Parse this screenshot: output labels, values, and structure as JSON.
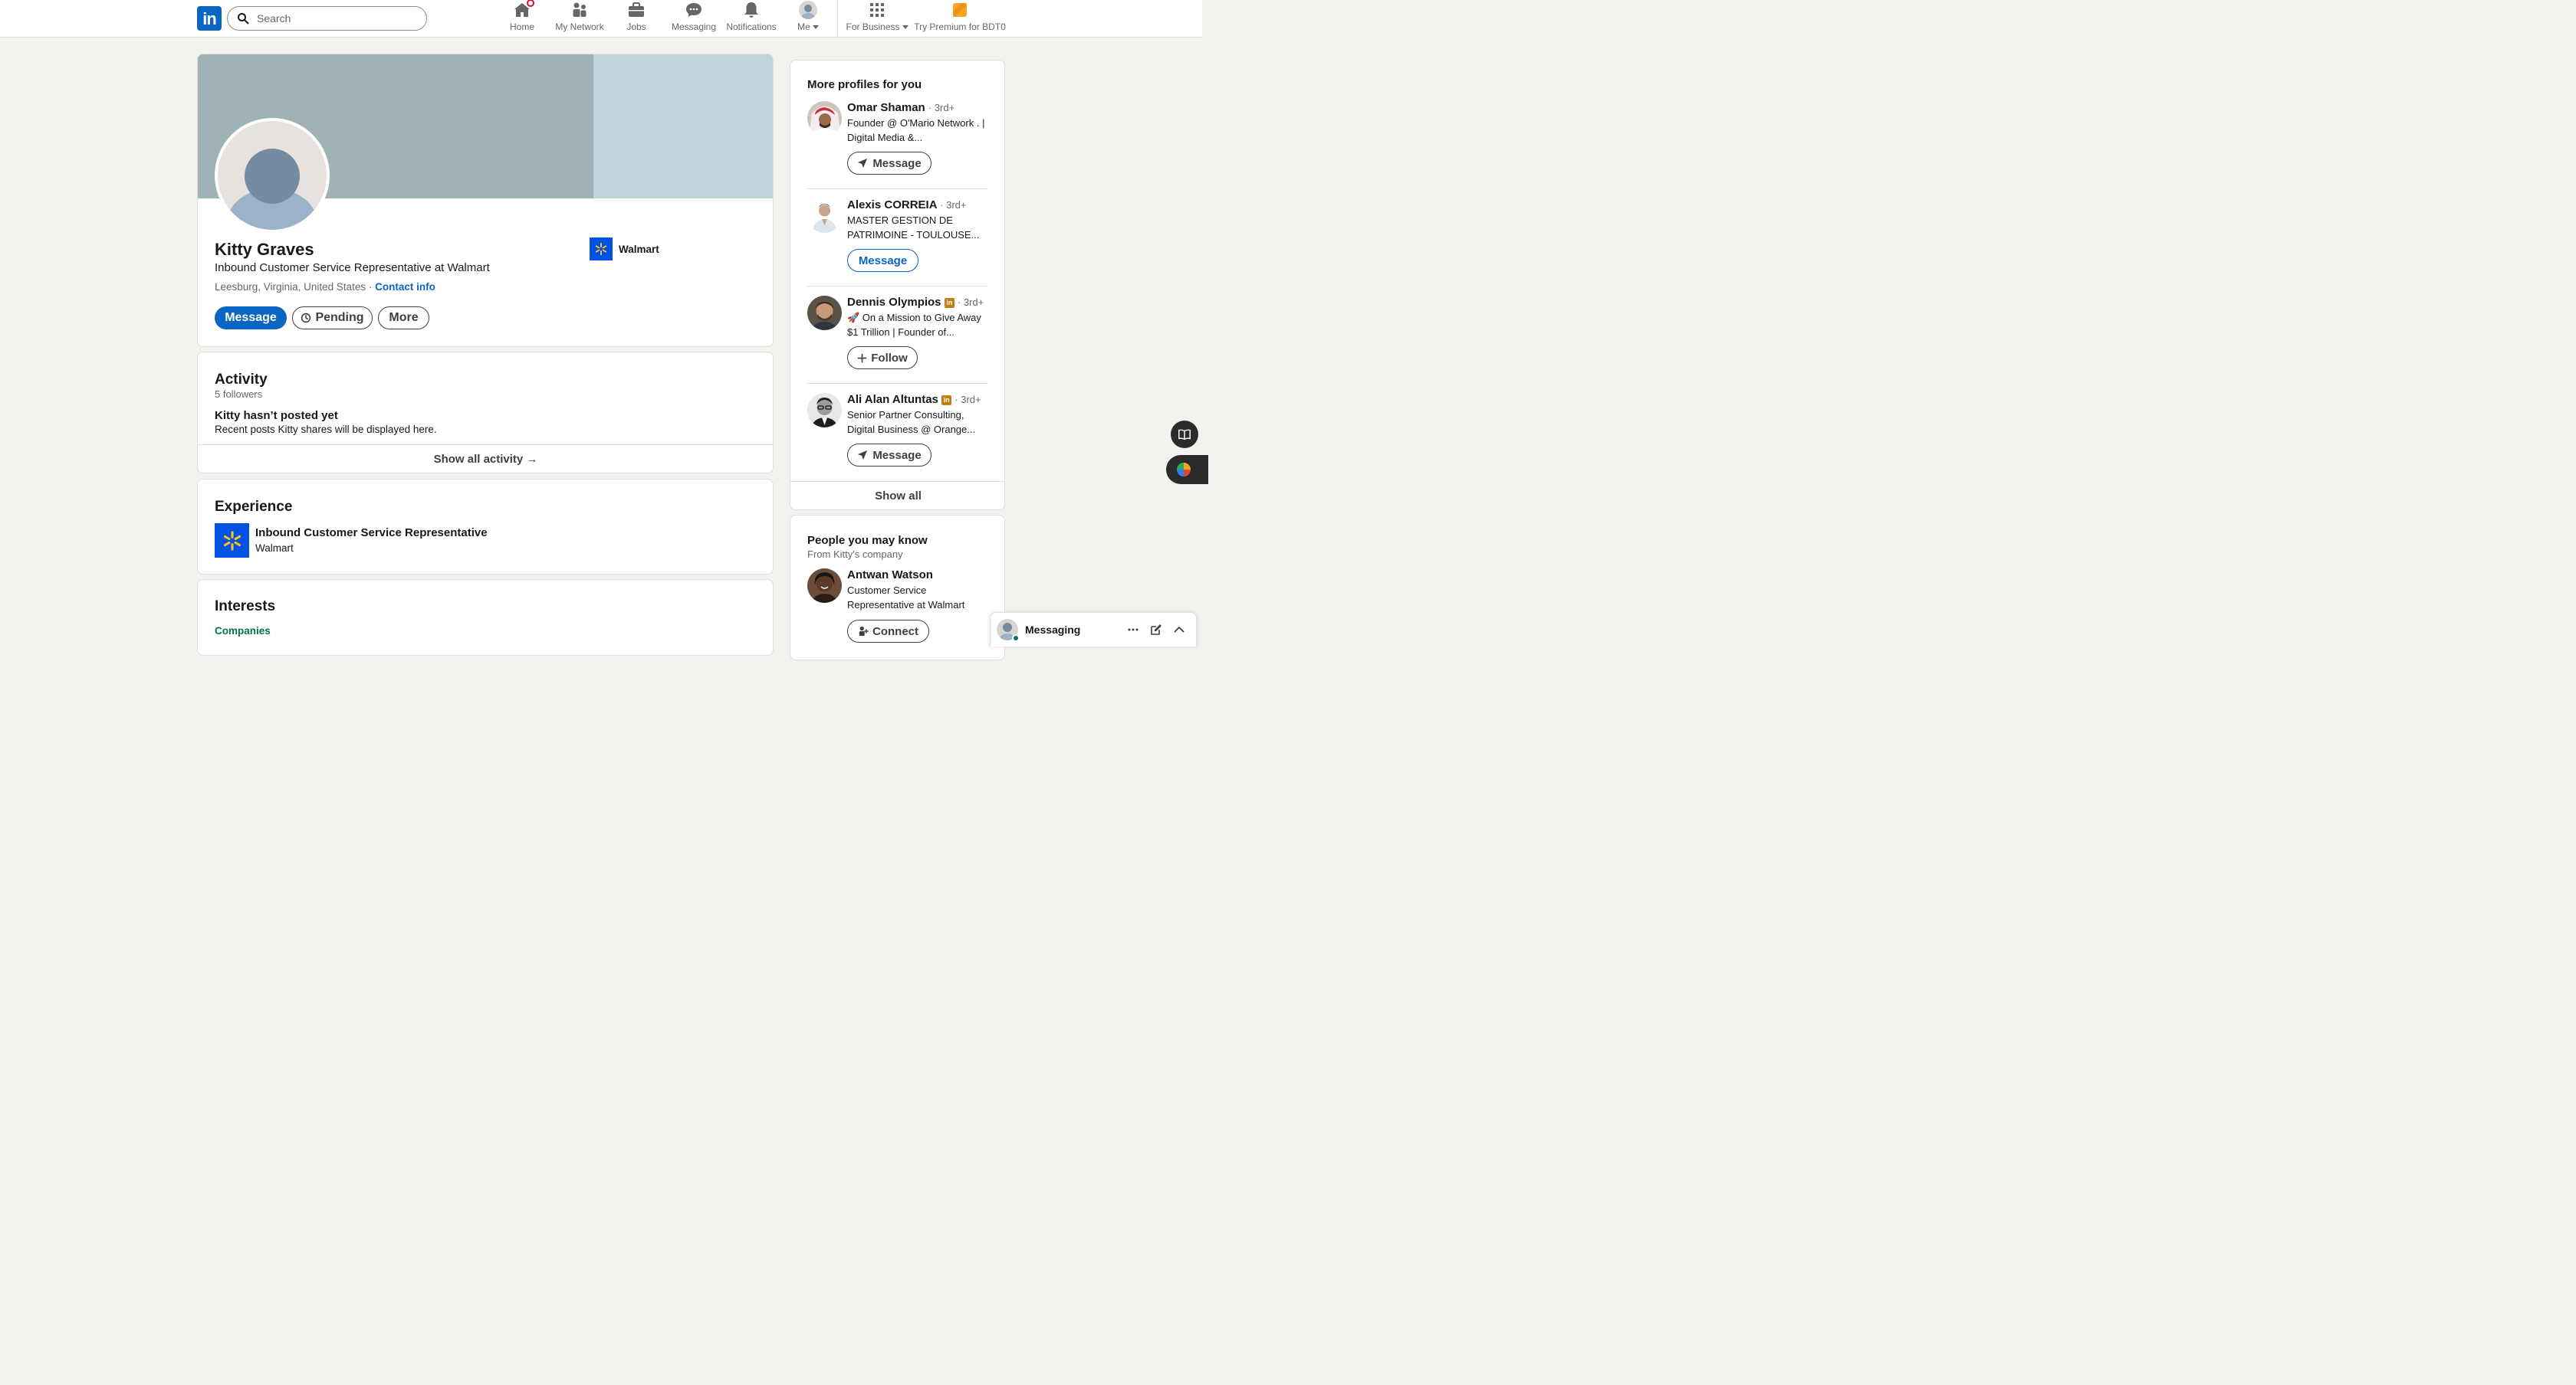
{
  "nav": {
    "search_placeholder": "Search",
    "items": [
      {
        "label": "Home",
        "icon": "home-icon"
      },
      {
        "label": "My Network",
        "icon": "people-icon"
      },
      {
        "label": "Jobs",
        "icon": "briefcase-icon"
      },
      {
        "label": "Messaging",
        "icon": "chat-icon"
      },
      {
        "label": "Notifications",
        "icon": "bell-icon"
      },
      {
        "label": "Me",
        "icon": "avatar"
      },
      {
        "label": "For Business",
        "icon": "grid-icon"
      },
      {
        "label": "Try Premium for BDT0",
        "icon": "premium-icon"
      }
    ]
  },
  "profile": {
    "name": "Kitty Graves",
    "headline": "Inbound Customer Service Representative at Walmart",
    "location": "Leesburg, Virginia, United States",
    "sep": "·",
    "contact_info": "Contact info",
    "company": "Walmart",
    "actions": {
      "message": "Message",
      "pending": "Pending",
      "more": "More"
    }
  },
  "activity": {
    "title": "Activity",
    "followers": "5 followers",
    "empty_title": "Kitty hasn’t posted yet",
    "empty_desc": "Recent posts Kitty shares will be displayed here.",
    "show_all": "Show all activity →"
  },
  "experience": {
    "title": "Experience",
    "role": "Inbound Customer Service Representative",
    "company": "Walmart"
  },
  "interests": {
    "title": "Interests",
    "tab": "Companies"
  },
  "more_profiles": {
    "title": "More profiles for you",
    "people": [
      {
        "name": "Omar Shaman",
        "degree": "· 3rd+",
        "headline": "Founder @ O'Mario Network . | Digital Media &...",
        "action": "Message",
        "badge": false
      },
      {
        "name": "Alexis CORREIA",
        "degree": "· 3rd+",
        "headline": "MASTER GESTION DE PATRIMOINE - TOULOUSE...",
        "action": "Message",
        "badge": false
      },
      {
        "name": "Dennis Olympios",
        "degree": "· 3rd+",
        "headline": "🚀 On a Mission to Give Away $1 Trillion | Founder of...",
        "action": "Follow",
        "badge": true
      },
      {
        "name": "Ali Alan Altuntas",
        "degree": "· 3rd+",
        "headline": "Senior Partner Consulting, Digital Business @ Orange...",
        "action": "Message",
        "badge": true
      }
    ],
    "show_all": "Show all"
  },
  "people_know": {
    "title": "People you may know",
    "subtitle": "From Kitty's company",
    "person": {
      "name": "Antwan Watson",
      "headline": "Customer Service Representative at Walmart",
      "action": "Connect"
    }
  },
  "messaging": {
    "label": "Messaging"
  },
  "colors": {
    "brand": "#0a66c2",
    "walmart": "#0053e2",
    "walmart_spark": "#ffc220",
    "premium": "#f5a623"
  }
}
